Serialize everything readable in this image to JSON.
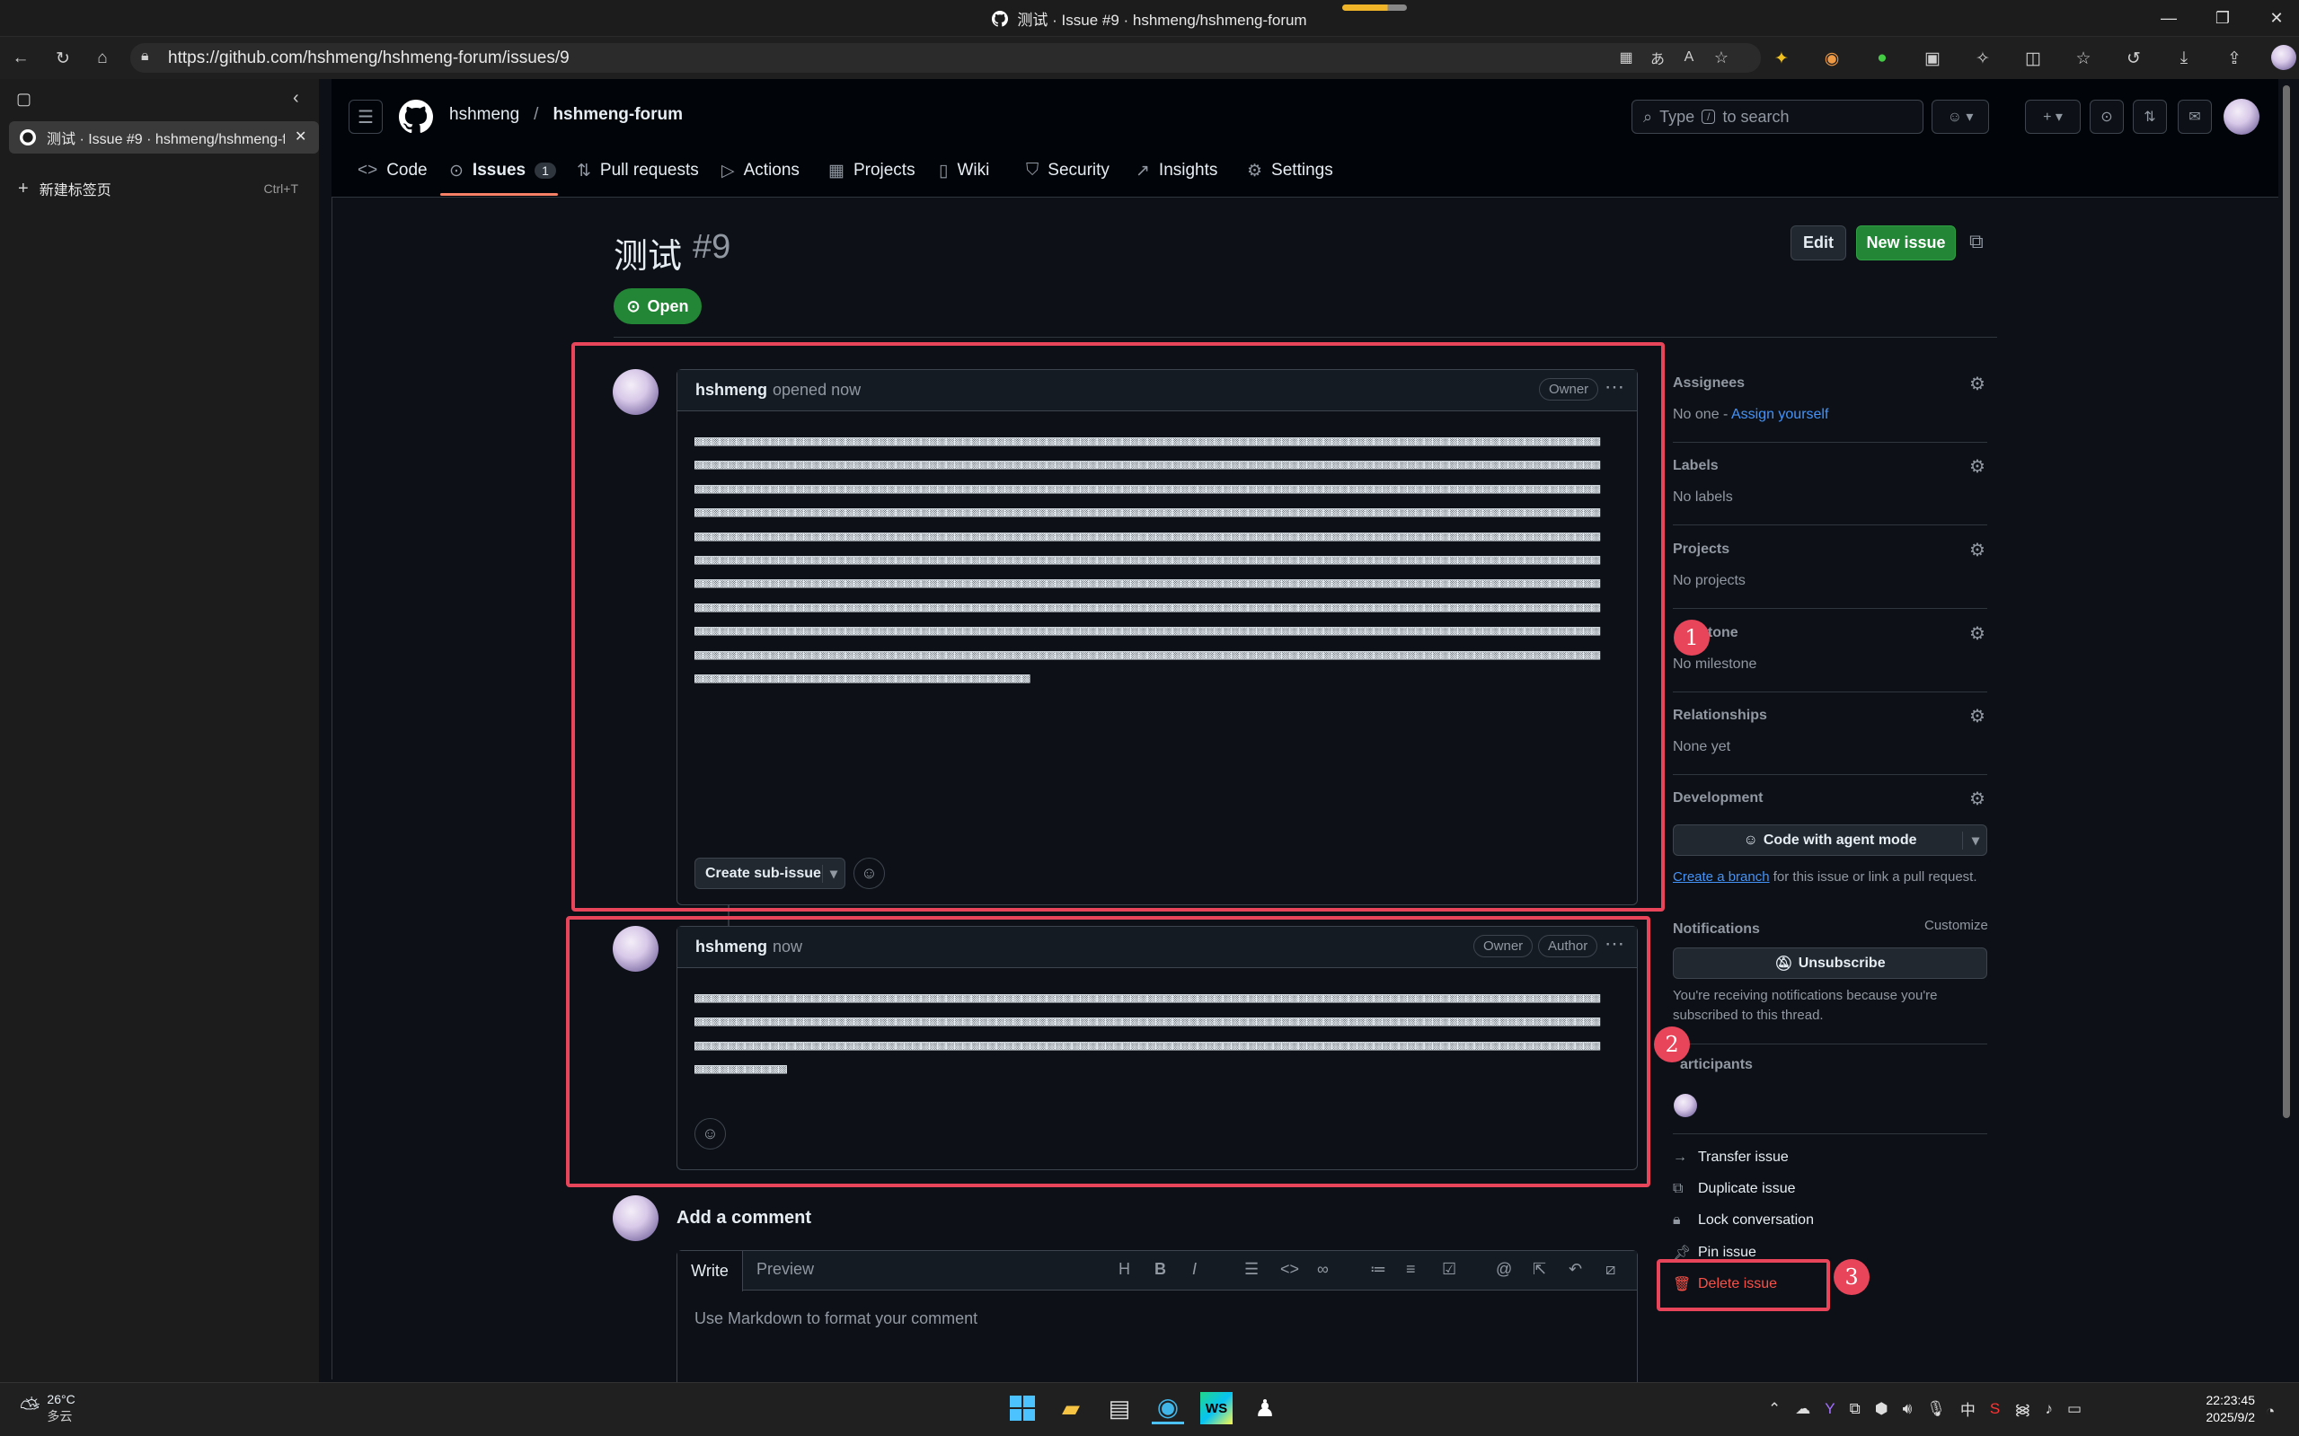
{
  "window": {
    "title": "测试 · Issue #9 · hshmeng/hshmeng-forum"
  },
  "browser": {
    "url": "https://github.com/hshmeng/hshmeng-forum/issues/9",
    "tab_title": "测试 · Issue #9 · hshmeng/hshmeng-forum",
    "new_tab_label": "新建标签页",
    "new_tab_shortcut": "Ctrl+T"
  },
  "repo": {
    "owner": "hshmeng",
    "sep": "/",
    "name": "hshmeng-forum"
  },
  "search": {
    "before": "Type",
    "key": "/",
    "after": "to search"
  },
  "nav": {
    "tabs": [
      {
        "label": "Code",
        "icon": "code-icon"
      },
      {
        "label": "Issues",
        "icon": "issue-opened-icon",
        "count": "1",
        "selected": true
      },
      {
        "label": "Pull requests",
        "icon": "git-pull-request-icon"
      },
      {
        "label": "Actions",
        "icon": "play-icon"
      },
      {
        "label": "Projects",
        "icon": "table-icon"
      },
      {
        "label": "Wiki",
        "icon": "book-icon"
      },
      {
        "label": "Security",
        "icon": "shield-icon"
      },
      {
        "label": "Insights",
        "icon": "graph-icon"
      },
      {
        "label": "Settings",
        "icon": "gear-icon"
      }
    ]
  },
  "issue": {
    "title": "测试",
    "number": "#9",
    "state": "Open",
    "edit_label": "Edit",
    "new_issue_label": "New issue"
  },
  "comments": [
    {
      "author": "hshmeng",
      "meta": "opened now",
      "badges": [
        "Owner"
      ],
      "sub_issue_label": "Create sub-issue"
    },
    {
      "author": "hshmeng",
      "meta": "now",
      "badges": [
        "Owner",
        "Author"
      ]
    }
  ],
  "add_comment": {
    "heading": "Add a comment",
    "tab_write": "Write",
    "tab_preview": "Preview",
    "placeholder": "Use Markdown to format your comment",
    "toolbar": [
      "H",
      "B",
      "I"
    ]
  },
  "sidebar": {
    "assignees": {
      "label": "Assignees",
      "value": "No one - ",
      "link": "Assign yourself"
    },
    "labels": {
      "label": "Labels",
      "value": "No labels"
    },
    "projects": {
      "label": "Projects",
      "value": "No projects"
    },
    "milestone": {
      "label": "Milestone",
      "label_visible": "stone",
      "value": "No milestone"
    },
    "relationships": {
      "label": "Relationships",
      "value": "None yet"
    },
    "development": {
      "label": "Development",
      "button": "Code with agent mode",
      "link": "Create a branch",
      "text": " for this issue or link a pull request."
    },
    "notifications": {
      "label": "Notifications",
      "customize": "Customize",
      "button": "Unsubscribe",
      "text": "You're receiving notifications because you're subscribed to this thread."
    },
    "participants": {
      "label": "Participants",
      "label_visible": "articipants"
    },
    "actions": [
      {
        "label": "Transfer issue",
        "icon": "arrow-right-icon"
      },
      {
        "label": "Duplicate issue",
        "icon": "copy-icon"
      },
      {
        "label": "Lock conversation",
        "icon": "lock-icon"
      },
      {
        "label": "Pin issue",
        "icon": "pin-icon"
      },
      {
        "label": "Delete issue",
        "icon": "trash-icon",
        "danger": true
      }
    ]
  },
  "annotations": [
    "1",
    "2",
    "3"
  ],
  "taskbar": {
    "weather_temp": "26°C",
    "weather_desc": "多云",
    "time": "22:23:45",
    "date": "2025/9/2",
    "ime": "中"
  },
  "colors": {
    "accent_red": "#e8445a",
    "open_green": "#238636",
    "link_blue": "#4493f8",
    "danger": "#f85149"
  }
}
